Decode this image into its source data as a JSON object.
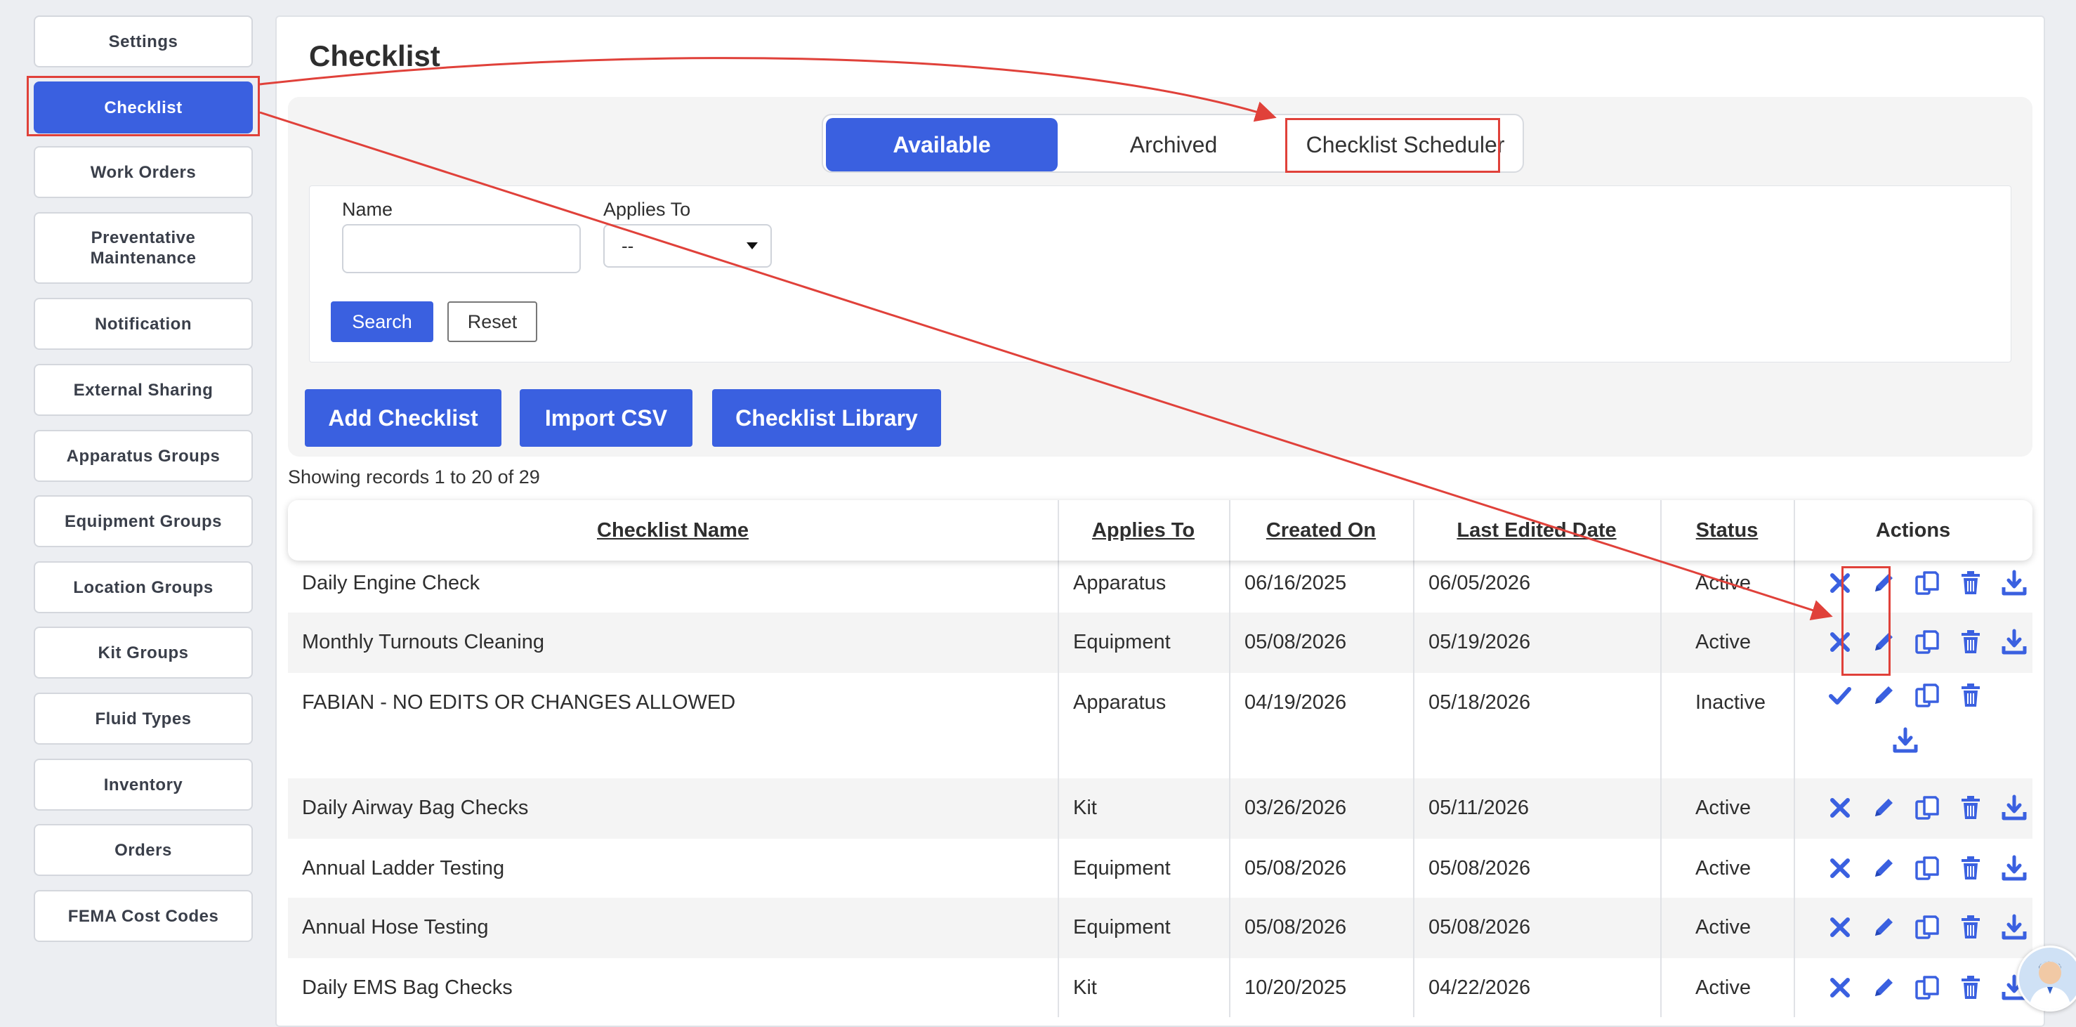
{
  "sidebar": {
    "items": [
      {
        "label": "Settings"
      },
      {
        "label": "Checklist",
        "active": true
      },
      {
        "label": "Work Orders"
      },
      {
        "label": "Preventative Maintenance"
      },
      {
        "label": "Notification"
      },
      {
        "label": "External Sharing"
      },
      {
        "label": "Apparatus Groups"
      },
      {
        "label": "Equipment Groups"
      },
      {
        "label": "Location Groups"
      },
      {
        "label": "Kit Groups"
      },
      {
        "label": "Fluid Types"
      },
      {
        "label": "Inventory"
      },
      {
        "label": "Orders"
      },
      {
        "label": "FEMA Cost Codes"
      }
    ]
  },
  "main": {
    "title": "Checklist",
    "tabs": [
      {
        "label": "Available",
        "active": true
      },
      {
        "label": "Archived"
      },
      {
        "label": "Checklist Scheduler"
      }
    ],
    "filters": {
      "name_label": "Name",
      "name_value": "",
      "applies_to_label": "Applies To",
      "applies_to_value": "--",
      "search_label": "Search",
      "reset_label": "Reset"
    },
    "buttons": {
      "add_checklist": "Add Checklist",
      "import_csv": "Import CSV",
      "checklist_library": "Checklist Library"
    },
    "records_text": "Showing records 1 to 20 of 29"
  },
  "table": {
    "headers": {
      "name": "Checklist Name",
      "applies_to": "Applies To",
      "created_on": "Created On",
      "last_edited": "Last Edited Date",
      "status": "Status",
      "actions": "Actions"
    },
    "rows": [
      {
        "name": "Daily Engine Check",
        "applies_to": "Apparatus",
        "created_on": "06/16/2025",
        "last_edited": "06/05/2026",
        "status": "Active"
      },
      {
        "name": "Monthly Turnouts Cleaning",
        "applies_to": "Equipment",
        "created_on": "05/08/2026",
        "last_edited": "05/19/2026",
        "status": "Active"
      },
      {
        "name": "FABIAN - NO EDITS OR CHANGES ALLOWED",
        "applies_to": "Apparatus",
        "created_on": "04/19/2026",
        "last_edited": "05/18/2026",
        "status": "Inactive"
      },
      {
        "name": "Daily Airway Bag Checks",
        "applies_to": "Kit",
        "created_on": "03/26/2026",
        "last_edited": "05/11/2026",
        "status": "Active"
      },
      {
        "name": "Annual Ladder Testing",
        "applies_to": "Equipment",
        "created_on": "05/08/2026",
        "last_edited": "05/08/2026",
        "status": "Active"
      },
      {
        "name": "Annual Hose Testing",
        "applies_to": "Equipment",
        "created_on": "05/08/2026",
        "last_edited": "05/08/2026",
        "status": "Active"
      },
      {
        "name": "Daily EMS Bag Checks",
        "applies_to": "Kit",
        "created_on": "10/20/2025",
        "last_edited": "04/22/2026",
        "status": "Active"
      }
    ]
  },
  "icons": {
    "deactivate": "x-icon",
    "activate": "check-icon",
    "edit": "pencil-icon",
    "copy": "copy-icon",
    "delete": "trash-icon",
    "download": "download-icon"
  },
  "colors": {
    "primary": "#3a60e0",
    "annotation": "#e0413a",
    "panel": "#f4f4f4"
  }
}
